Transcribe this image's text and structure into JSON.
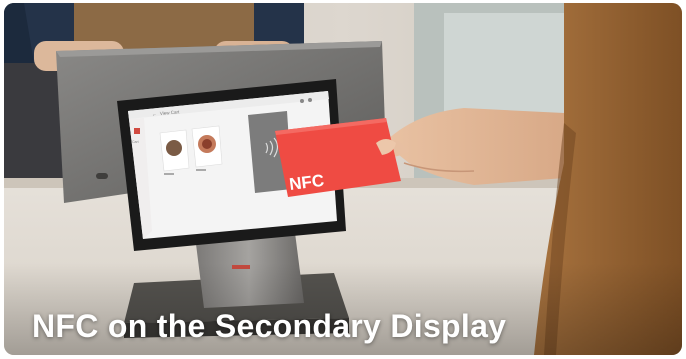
{
  "caption": "NFC on the Secondary Display",
  "card": {
    "label": "NFC"
  },
  "screen": {
    "ui": {
      "back_arrow": "←",
      "title": "View Cart",
      "tab": "Cart"
    }
  },
  "colors": {
    "card_red": "#ef4b43",
    "screen_bg": "#f4f4f4",
    "device_gray": "#6a6968"
  },
  "icons": [
    "nfc-contactless-icon",
    "back-arrow-icon"
  ]
}
